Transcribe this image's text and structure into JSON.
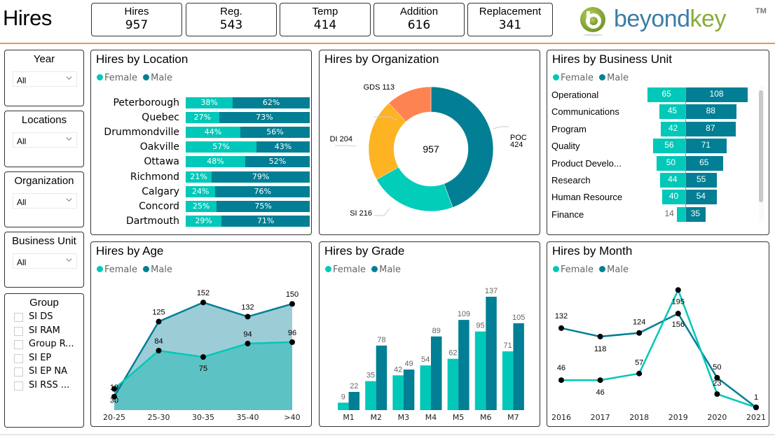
{
  "header": {
    "title": "Hires",
    "kpis": [
      {
        "label": "Hires",
        "value": "957"
      },
      {
        "label": "Reg.",
        "value": "543"
      },
      {
        "label": "Temp",
        "value": "414"
      },
      {
        "label": "Addition",
        "value": "616"
      },
      {
        "label": "Replacement",
        "value": "341"
      }
    ],
    "logo": {
      "text_primary": "beyond",
      "text_secondary": "key",
      "trademark": "TM"
    }
  },
  "filters": {
    "slicers": [
      {
        "title": "Year",
        "selected": "All"
      },
      {
        "title": "Locations",
        "selected": "All"
      },
      {
        "title": "Organization",
        "selected": "All"
      },
      {
        "title": "Business Unit",
        "selected": "All"
      }
    ],
    "group": {
      "title": "Group",
      "items": [
        "SI DS",
        "SI RAM",
        "Group R...",
        "SI EP",
        "SI EP NA",
        "SI RSS ..."
      ]
    }
  },
  "colors": {
    "female": "#01c8b8",
    "male": "#027f94",
    "male_area": "#9ccdd6",
    "female_area": "#5dc2c4",
    "poc": "#027f94",
    "si": "#01cdb9",
    "di": "#fdb322",
    "gds": "#fd8452"
  },
  "legend": {
    "female": "Female",
    "male": "Male"
  },
  "chart_data": [
    {
      "id": "location",
      "type": "bar",
      "subtype": "100% stacked horizontal",
      "title": "Hires by Location",
      "categories": [
        "Peterborough",
        "Quebec",
        "Drummondville",
        "Oakville",
        "Ottawa",
        "Richmond",
        "Calgary",
        "Concord",
        "Dartmouth"
      ],
      "series": [
        {
          "name": "Female",
          "values": [
            38,
            27,
            44,
            57,
            48,
            21,
            24,
            25,
            29
          ],
          "labels": [
            "38%",
            "27%",
            "44%",
            "57%",
            "48%",
            "21%",
            "24%",
            "25%",
            "29%"
          ]
        },
        {
          "name": "Male",
          "values": [
            62,
            73,
            56,
            43,
            52,
            79,
            76,
            75,
            71
          ],
          "labels": [
            "62%",
            "73%",
            "56%",
            "43%",
            "52%",
            "79%",
            "76%",
            "75%",
            "71%"
          ]
        }
      ],
      "legend": "top-left"
    },
    {
      "id": "organization",
      "type": "pie",
      "subtype": "donut",
      "title": "Hires by Organization",
      "center_label": "957",
      "slices": [
        {
          "name": "POC",
          "value": 424,
          "label_name": "POC",
          "label_value": "424"
        },
        {
          "name": "SI",
          "value": 216,
          "label": "SI 216"
        },
        {
          "name": "DI",
          "value": 204,
          "label": "DI 204"
        },
        {
          "name": "GDS",
          "value": 113,
          "label": "GDS 113"
        }
      ]
    },
    {
      "id": "business_unit",
      "type": "bar",
      "subtype": "diverging horizontal",
      "title": "Hires by Business Unit",
      "categories": [
        "Operational",
        "Communications",
        "Program",
        "Quality",
        "Product Develo...",
        "Research",
        "Human Resource",
        "Finance"
      ],
      "series": [
        {
          "name": "Female",
          "values": [
            65,
            45,
            42,
            56,
            50,
            44,
            40,
            14
          ]
        },
        {
          "name": "Male",
          "values": [
            108,
            88,
            87,
            71,
            65,
            55,
            54,
            35
          ]
        }
      ],
      "legend": "top-left"
    },
    {
      "id": "age",
      "type": "area",
      "title": "Hires by Age",
      "categories": [
        "20-25",
        "25-30",
        "30-35",
        "35-40",
        ">40"
      ],
      "series": [
        {
          "name": "Female",
          "values": [
            30,
            84,
            75,
            94,
            96
          ]
        },
        {
          "name": "Male",
          "values": [
            19,
            125,
            152,
            132,
            150
          ]
        }
      ],
      "ylim": [
        0,
        170
      ],
      "legend": "top-left"
    },
    {
      "id": "grade",
      "type": "bar",
      "subtype": "clustered column",
      "title": "Hires by Grade",
      "categories": [
        "M1",
        "M2",
        "M3",
        "M4",
        "M5",
        "M6",
        "M7"
      ],
      "series": [
        {
          "name": "Female",
          "values": [
            9,
            35,
            42,
            54,
            62,
            95,
            71
          ]
        },
        {
          "name": "Male",
          "values": [
            22,
            78,
            49,
            89,
            109,
            137,
            105
          ]
        }
      ],
      "ylim": [
        0,
        137
      ],
      "legend": "top-left"
    },
    {
      "id": "month",
      "type": "line",
      "title": "Hires by Month",
      "categories": [
        "2016",
        "2017",
        "2018",
        "2019",
        "2020",
        "2021"
      ],
      "series": [
        {
          "name": "Female",
          "values": [
            46,
            46,
            57,
            195,
            23,
            1
          ]
        },
        {
          "name": "Male",
          "values": [
            132,
            118,
            124,
            156,
            50,
            1
          ]
        }
      ],
      "ylim": [
        0,
        200
      ],
      "legend": "top-left"
    }
  ]
}
